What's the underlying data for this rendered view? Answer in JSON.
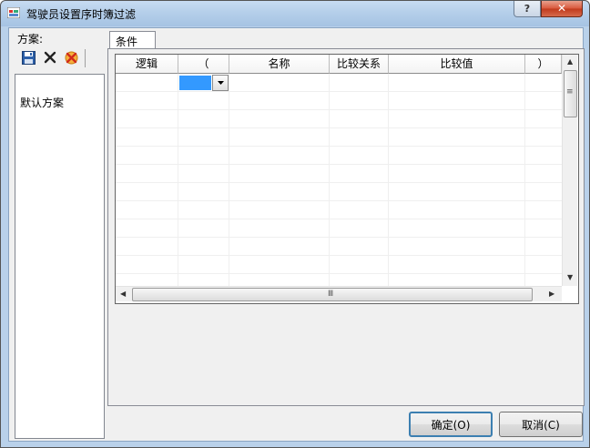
{
  "window": {
    "title": "驾驶员设置序时簿过滤",
    "help_label": "?",
    "close_label": "✕"
  },
  "left": {
    "scheme_label": "方案:",
    "toolbar": {
      "save_icon": "save-icon",
      "delete_icon": "delete-icon",
      "reset_icon": "reset-icon"
    },
    "schemes": [
      "默认方案"
    ]
  },
  "tabs": [
    {
      "label": "条件",
      "selected": true
    }
  ],
  "grid": {
    "columns": [
      "逻辑",
      "（",
      "名称",
      "比较关系",
      "比较值",
      "）"
    ],
    "rows": [
      {
        "逻辑": "",
        "（": "",
        "名称": "",
        "比较关系": "",
        "比较值": "",
        "）": ""
      }
    ],
    "h_scroll_grip": "Ⅲ",
    "v_scroll_grip": "≡"
  },
  "buttons": {
    "ok_label": "确定(O)",
    "cancel_label": "取消(C)"
  },
  "colors": {
    "selection": "#3399ff",
    "client_bg": "#f0f0f0"
  }
}
